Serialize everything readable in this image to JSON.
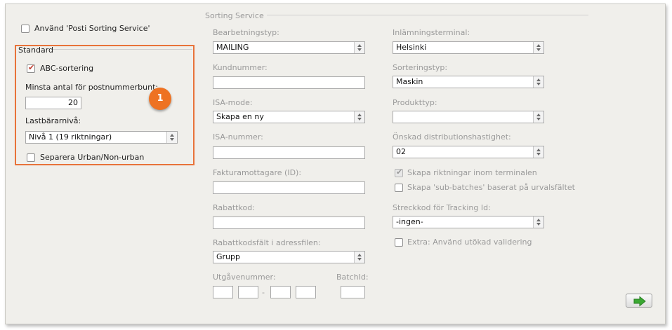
{
  "use_service_label": "Använd 'Posti Sorting Service'",
  "standard": {
    "legend": "Standard",
    "abc_label": "ABC-sortering",
    "min_count_label": "Minsta antal för postnummerbunt:",
    "min_count_value": "20",
    "carrier_level_label": "Lastbärarnivå:",
    "carrier_level_value": "Nivå 1 (19 riktningar)",
    "separate_label": "Separera Urban/Non-urban",
    "badge": "1"
  },
  "section_title": "Sorting Service",
  "left_col": {
    "processing_type_label": "Bearbetningstyp:",
    "processing_type_value": "MAILING",
    "customer_no_label": "Kundnummer:",
    "customer_no_value": "",
    "isa_mode_label": "ISA-mode:",
    "isa_mode_value": "Skapa en ny",
    "isa_number_label": "ISA-nummer:",
    "isa_number_value": "",
    "invoice_recipient_label": "Fakturamottagare (ID):",
    "invoice_recipient_value": "",
    "discount_code_label": "Rabattkod:",
    "discount_code_value": "",
    "discount_field_label": "Rabattkodsfält i adressfilen:",
    "discount_field_value": "Grupp",
    "issue_number_label": "Utgåvenummer:",
    "dash": "-",
    "batch_id_label": "BatchId:"
  },
  "right_col": {
    "terminal_label": "Inlämningsterminal:",
    "terminal_value": "Helsinki",
    "sorting_type_label": "Sorteringstyp:",
    "sorting_type_value": "Maskin",
    "product_type_label": "Produkttyp:",
    "product_type_value": "",
    "speed_label": "Önskad distributionshastighet:",
    "speed_value": "02",
    "create_directions_label": "Skapa riktningar inom terminalen",
    "create_subbatches_label": "Skapa 'sub-batches' baserat på urvalsfältet",
    "barcode_label": "Streckkod för Tracking Id:",
    "barcode_value": "-ingen-",
    "extra_validation_label": "Extra: Använd utökad validering"
  },
  "colors": {
    "highlight": "#e8733a",
    "badge": "#ee7222",
    "arrow": "#3aa832"
  }
}
